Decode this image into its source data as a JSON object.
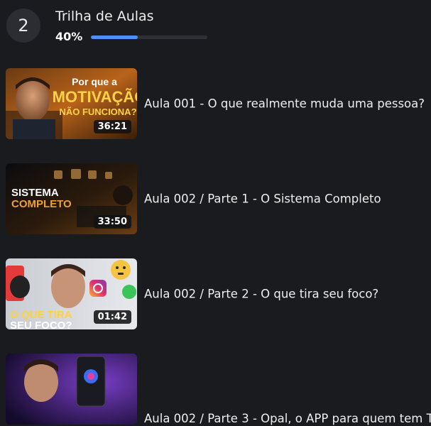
{
  "header": {
    "section_number": "2",
    "title": "Trilha de Aulas",
    "progress_label": "40%",
    "progress_fraction": 0.4,
    "accent_color": "#4f8ff7"
  },
  "lessons": [
    {
      "title": "Aula 001 - O que realmente muda uma pessoa?",
      "duration": "36:21",
      "thumb_text": [
        "Por que a",
        "MOTIVAÇÃO",
        "NÃO FUNCIONA?"
      ]
    },
    {
      "title": "Aula 002 / Parte 1 - O Sistema Completo",
      "duration": "33:50",
      "thumb_text": [
        "SISTEMA",
        "COMPLETO"
      ]
    },
    {
      "title": "Aula 002 / Parte 2 - O que tira seu foco?",
      "duration": "01:42",
      "thumb_text": [
        "O QUE TIRA",
        "SEU FOCO?"
      ]
    },
    {
      "title": "Aula 002 / Parte 3 - Opal, o APP para quem tem T",
      "duration": "",
      "thumb_text": []
    }
  ]
}
